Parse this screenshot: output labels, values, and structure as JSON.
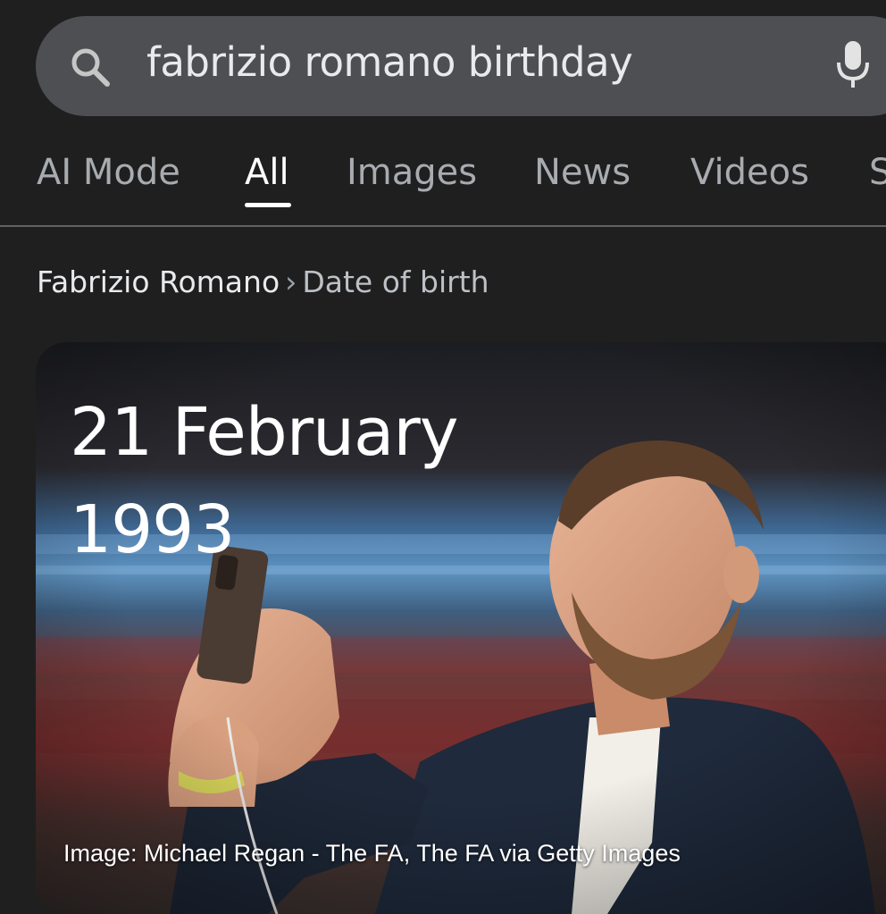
{
  "search": {
    "query": "fabrizio romano birthday",
    "icon": "search-icon",
    "mic_icon": "microphone-icon"
  },
  "tabs": [
    {
      "label": "AI Mode",
      "active": false
    },
    {
      "label": "All",
      "active": true
    },
    {
      "label": "Images",
      "active": false
    },
    {
      "label": "News",
      "active": false
    },
    {
      "label": "Videos",
      "active": false
    },
    {
      "label": "S",
      "active": false
    }
  ],
  "breadcrumb": {
    "entity": "Fabrizio Romano",
    "separator": "›",
    "attribute": "Date of birth"
  },
  "answer_card": {
    "date_line1": "21 February",
    "date_line2": "1993",
    "image_credit": "Image: Michael Regan - The FA, The FA via Getty Images"
  },
  "colors": {
    "background": "#1f1f1f",
    "search_bar": "#4d4f53",
    "tab_inactive": "#a8abaf",
    "tab_active": "#ffffff"
  }
}
